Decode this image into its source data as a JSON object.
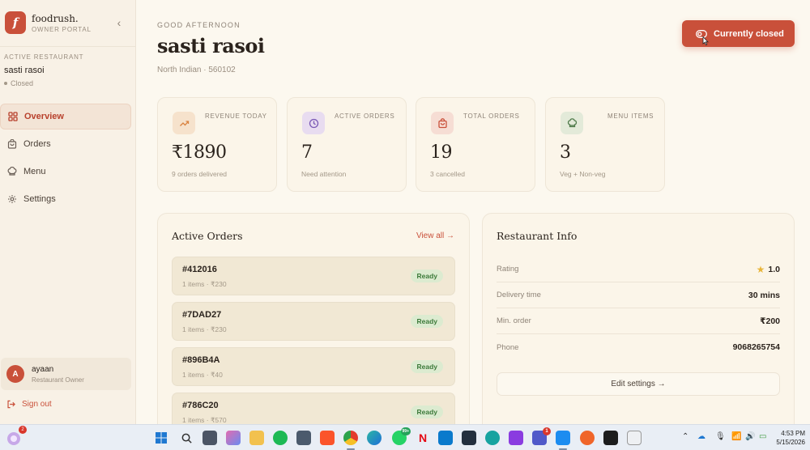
{
  "brand": {
    "logo_letter": "f",
    "name": "foodrush.",
    "subtitle": "OWNER PORTAL"
  },
  "active_restaurant": {
    "label": "ACTIVE RESTAURANT",
    "name": "sasti rasoi",
    "status": "Closed"
  },
  "nav": [
    {
      "label": "Overview",
      "icon": "grid-icon",
      "active": true
    },
    {
      "label": "Orders",
      "icon": "bag-icon",
      "active": false
    },
    {
      "label": "Menu",
      "icon": "chef-hat-icon",
      "active": false
    },
    {
      "label": "Settings",
      "icon": "gear-icon",
      "active": false
    }
  ],
  "user": {
    "initial": "A",
    "name": "ayaan",
    "role": "Restaurant Owner"
  },
  "signout_label": "Sign out",
  "header": {
    "greeting": "GOOD AFTERNOON",
    "title": "sasti rasoi",
    "meta": "North Indian · 560102",
    "status_button": "Currently closed"
  },
  "stats": [
    {
      "label": "REVENUE TODAY",
      "value": "₹1890",
      "sub": "9 orders delivered",
      "icon": "trending-up-icon",
      "accent": "#d9823f"
    },
    {
      "label": "ACTIVE ORDERS",
      "value": "7",
      "sub": "Need attention",
      "icon": "clock-icon",
      "accent": "#7a58b5"
    },
    {
      "label": "TOTAL ORDERS",
      "value": "19",
      "sub": "3 cancelled",
      "icon": "bag-icon",
      "accent": "#c9503a"
    },
    {
      "label": "MENU ITEMS",
      "value": "3",
      "sub": "Veg + Non-veg",
      "icon": "chef-hat-icon",
      "accent": "#4f7a4a"
    }
  ],
  "active_orders": {
    "title": "Active Orders",
    "view_all": "View all →",
    "orders": [
      {
        "id": "#412016",
        "meta": "1 items · ₹230",
        "status": "Ready"
      },
      {
        "id": "#7DAD27",
        "meta": "1 items · ₹230",
        "status": "Ready"
      },
      {
        "id": "#896B4A",
        "meta": "1 items · ₹40",
        "status": "Ready"
      },
      {
        "id": "#786C20",
        "meta": "1 items · ₹570",
        "status": "Ready"
      }
    ]
  },
  "restaurant_info": {
    "title": "Restaurant Info",
    "rows": [
      {
        "key": "Rating",
        "value": "1.0"
      },
      {
        "key": "Delivery time",
        "value": "30 mins"
      },
      {
        "key": "Min. order",
        "value": "₹200"
      },
      {
        "key": "Phone",
        "value": "9068265754"
      }
    ],
    "edit_button": "Edit settings →"
  },
  "taskbar": {
    "notification_count": "2",
    "whatsapp_badge": "99+",
    "teams_badge": "1",
    "time": "4:53 PM",
    "date": "5/15/2026"
  },
  "colors": {
    "accent": "#c9503a",
    "background": "#fcf8ef",
    "ready_badge": "#dcebd0"
  }
}
